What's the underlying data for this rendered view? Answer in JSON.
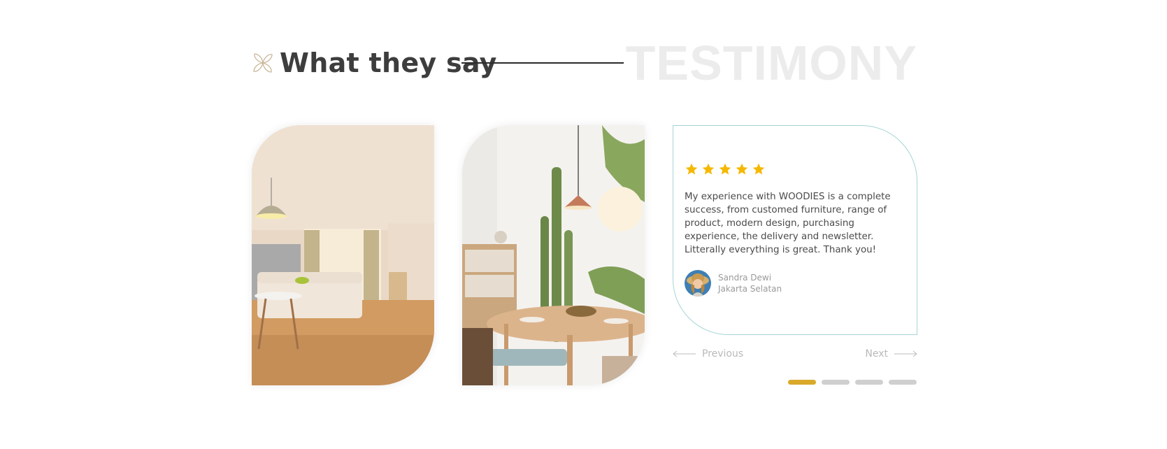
{
  "header": {
    "title": "What they say",
    "watermark": "TESTIMONY"
  },
  "photos": [
    {
      "name": "bedroom-photo",
      "description_icon": "image"
    },
    {
      "name": "dining-room-photo",
      "description_icon": "image"
    }
  ],
  "testimonial": {
    "rating": 5,
    "rating_max": 5,
    "quote": "My experience with WOODIES is a complete success, from customed furniture, range of product, modern design, purchasing experience, the delivery and newsletter. Litterally everything is great. Thank you!",
    "author_name": "Sandra Dewi",
    "author_location": "Jakarta Selatan"
  },
  "nav": {
    "previous_label": "Previous",
    "next_label": "Next"
  },
  "pagination": {
    "count": 4,
    "active_index": 0
  },
  "colors": {
    "accent": "#d9a92a",
    "star": "#f5b800",
    "card_border": "#a6d3d6",
    "text": "#3d3d3d"
  }
}
